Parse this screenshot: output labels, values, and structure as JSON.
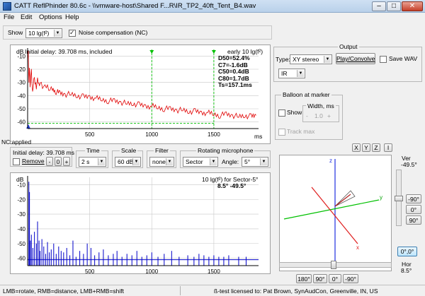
{
  "window": {
    "title": "CATT ReflPhinder 80.6c - \\\\vmware-host\\Shared F...R\\IR_TP2_40ft_Tent_B4.wav",
    "min": "–",
    "max": "□",
    "close": "✕"
  },
  "menu": {
    "file": "File",
    "edit": "Edit",
    "options": "Options",
    "help": "Help"
  },
  "toolbar": {
    "show_label": "Show",
    "show_value": "10 lg(f²)",
    "noise_label": "Noise compensation (NC)"
  },
  "top_plot": {
    "unit": "dB",
    "header": "Initial delay: 39.708 ms, included",
    "legend_title": "early 10 lg(f²)",
    "metrics": [
      "D50=52.4%",
      "C7=-1.6dB",
      "C50=0.4dB",
      "C80=1.7dB",
      "Ts=157.1ms"
    ],
    "y_ticks": [
      "-10",
      "-20",
      "-30",
      "-40",
      "-50",
      "-60"
    ],
    "x_ticks": [
      "500",
      "1000",
      "1500"
    ],
    "x_unit": "ms",
    "nc_label": "NC:applied",
    "chart_data": {
      "type": "line",
      "xlabel": "ms",
      "ylabel": "dB",
      "xlim": [
        0,
        1860
      ],
      "ylim": [
        -65,
        -5
      ],
      "series": [
        {
          "color": "#e00000",
          "x": [
            0,
            5,
            10,
            15,
            20,
            30,
            40,
            50,
            60,
            70,
            80,
            90,
            100,
            120,
            140,
            160,
            180,
            200,
            230,
            260,
            300,
            350,
            400,
            450,
            500,
            550,
            600,
            650,
            700,
            750,
            800,
            850,
            900,
            950,
            1000,
            1050,
            1100,
            1150,
            1200,
            1250,
            1300,
            1350,
            1400,
            1450,
            1500,
            1550,
            1600,
            1650,
            1700,
            1750,
            1800,
            1840
          ],
          "y": [
            -13,
            -6,
            -30,
            -19,
            -32,
            -22,
            -38,
            -27,
            -30,
            -33,
            -28,
            -31,
            -30,
            -33,
            -34,
            -33,
            -36,
            -35,
            -37,
            -38,
            -39,
            -39,
            -40,
            -41,
            -41,
            -42,
            -43,
            -44,
            -44,
            -45,
            -46,
            -46,
            -47,
            -48,
            -48,
            -49,
            -50,
            -50,
            -51,
            -51,
            -52,
            -52,
            -53,
            -53,
            -54,
            -55,
            -54,
            -55,
            -56,
            -55,
            -56,
            -55
          ]
        }
      ],
      "markers": [
        {
          "x": 1000,
          "color": "#00c000"
        },
        {
          "x": 1500,
          "color": "#00c000"
        }
      ]
    }
  },
  "controls": {
    "initial_delay": "Initial delay: 39.708 ms",
    "remove_label": "Remove",
    "minus": "-",
    "zero": "0",
    "plus": "+",
    "time_title": "Time",
    "time_value": "2 s",
    "scale_title": "Scale",
    "scale_value": "60 dB",
    "filter_title": "Filter",
    "filter_value": "none",
    "rotmic_title": "Rotating microphone",
    "rotmic_value": "Sector",
    "angle_label": "Angle:",
    "angle_value": "5°"
  },
  "bottom_plot": {
    "unit": "dB",
    "title": "10 lg(f²) for Sector-5°",
    "subtitle": "8.5°  -49.5°",
    "y_ticks": [
      "-10",
      "-20",
      "-30",
      "-40",
      "-50",
      "-60"
    ],
    "x_ticks": [
      "500",
      "1000",
      "1500"
    ],
    "x_unit": "ms",
    "chart_data": {
      "type": "bar",
      "xlabel": "ms",
      "ylabel": "dB",
      "xlim": [
        0,
        1860
      ],
      "ylim": [
        -65,
        -5
      ],
      "series": [
        {
          "color": "#0000c8",
          "x": [
            10,
            15,
            22,
            30,
            42,
            55,
            70,
            80,
            92,
            100,
            115,
            130,
            145,
            160,
            175,
            190,
            210,
            230,
            250,
            270,
            290,
            315,
            340,
            365,
            390,
            420,
            450,
            480,
            510,
            540,
            575,
            610,
            650,
            690,
            720,
            760,
            800,
            840,
            880,
            920,
            960,
            1000,
            1050,
            1100,
            1160,
            1220,
            1290,
            1340,
            1380,
            1420,
            1460,
            1500,
            1540,
            1580,
            1620,
            1700,
            1760
          ],
          "y": [
            -8,
            -15,
            -48,
            -44,
            -53,
            -42,
            -50,
            -35,
            -48,
            -55,
            -47,
            -52,
            -57,
            -49,
            -56,
            -54,
            -50,
            -57,
            -52,
            -55,
            -56,
            -53,
            -58,
            -48,
            -59,
            -55,
            -57,
            -50,
            -53,
            -58,
            -56,
            -54,
            -58,
            -57,
            -55,
            -59,
            -57,
            -58,
            -55,
            -59,
            -58,
            -56,
            -59,
            -57,
            -55,
            -59,
            -58,
            -59,
            -57,
            -58,
            -59,
            -58,
            -59,
            -59,
            -58,
            -59,
            -59
          ]
        }
      ]
    }
  },
  "output": {
    "title": "Output",
    "type_label": "Type:",
    "type_value": "XY stereo",
    "play_label": "Play/Convolve",
    "save_wav": "Save WAV",
    "ir_value": "IR"
  },
  "balloon": {
    "title": "Balloon at marker",
    "show_label": "Show",
    "width_title": "Width, ms",
    "width_value": "1.0",
    "track_label": "Track max"
  },
  "view3d": {
    "axis_buttons": [
      "X",
      "Y",
      "Z",
      "I"
    ],
    "axis_z": "z",
    "axis_y": "y",
    "axis_x": "x",
    "ver_label": "Ver",
    "ver_value": "-49.5°",
    "ver_buttons": [
      "-90°",
      "0°",
      "90°"
    ],
    "reset_button": "0°,0°",
    "hor_label": "Hor",
    "hor_value": "8.5°",
    "hor_buttons": [
      "180°",
      "90°",
      "0°",
      "-90°"
    ]
  },
  "status": {
    "left": "LMB=rotate, RMB=distance, LMB+RMB=shift",
    "right": "ß-test licensed to: Pat Brown, SynAudCon, Greenville, IN, US"
  }
}
